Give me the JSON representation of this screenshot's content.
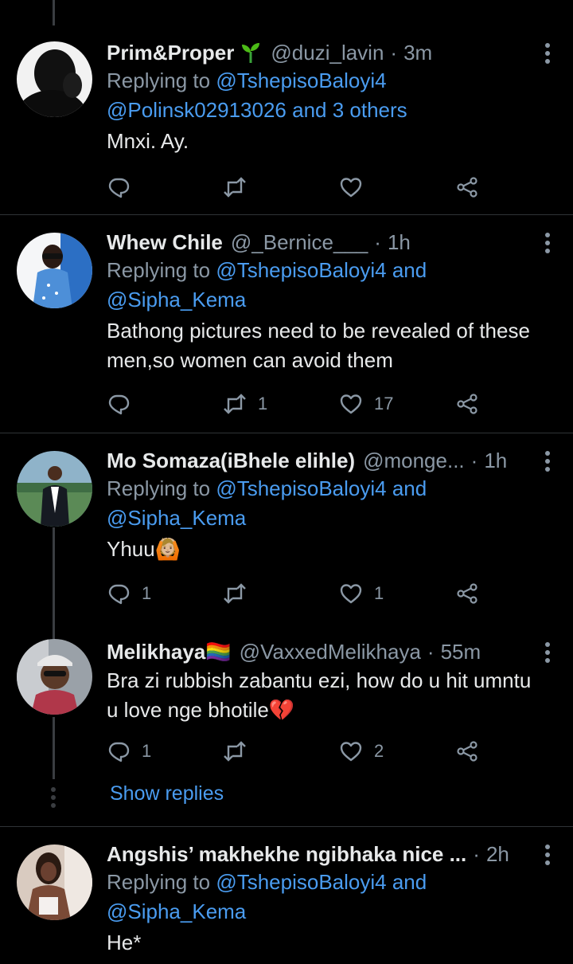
{
  "colors": {
    "background": "#000000",
    "text": "#e7e9ea",
    "muted": "#8b98a5",
    "link": "#4a9cf0",
    "divider": "#2f3336"
  },
  "tweets": [
    {
      "name": "Prim&Proper",
      "badge_icon": "seedling-icon",
      "handle": "@duzi_lavin",
      "separator": "·",
      "time": "3m",
      "replying_prefix": "Replying to ",
      "replying_mentions": "@TshepisoBaloyi4 @Polinsk02913026 and 3 others",
      "replying_and": "",
      "replying_second": "",
      "text": "Mnxi. Ay.",
      "reply_count": "",
      "retweet_count": "",
      "like_count": ""
    },
    {
      "name": "Whew Chile",
      "handle": "@_Bernice___",
      "separator": "·",
      "time": "1h",
      "replying_prefix": "Replying to ",
      "replying_mentions": "@TshepisoBaloyi4",
      "replying_and": " and",
      "replying_second": "@Sipha_Kema",
      "text": "Bathong pictures need to be revealed of these men,so women can avoid them",
      "reply_count": "",
      "retweet_count": "1",
      "like_count": "17"
    },
    {
      "name": "Mo Somaza(iBhele elihle)",
      "handle": "@monge...",
      "separator": "·",
      "time": "1h",
      "replying_prefix": "Replying to ",
      "replying_mentions": "@TshepisoBaloyi4",
      "replying_and": " and",
      "replying_second": "@Sipha_Kema",
      "text": "Yhuu🙆🏼",
      "reply_count": "1",
      "retweet_count": "",
      "like_count": "1"
    },
    {
      "name": "Melikhaya🏳️‍🌈",
      "handle": "@VaxxedMelikhaya",
      "separator": "·",
      "time": "55m",
      "text": "Bra zi rubbish zabantu ezi, how do u hit umntu u love nge bhotile💔",
      "reply_count": "1",
      "retweet_count": "",
      "like_count": "2"
    },
    {
      "name": "Angshis’ makhekhe ngibhaka nice ...",
      "handle": "",
      "separator": "·",
      "time": "2h",
      "replying_prefix": "Replying to ",
      "replying_mentions": "@TshepisoBaloyi4",
      "replying_and": " and",
      "replying_second": "@Sipha_Kema",
      "text": "He*"
    }
  ],
  "show_replies": "Show replies",
  "icons": {
    "reply": "reply-icon",
    "retweet": "retweet-icon",
    "like": "heart-icon",
    "share": "share-icon",
    "more": "more-icon"
  }
}
